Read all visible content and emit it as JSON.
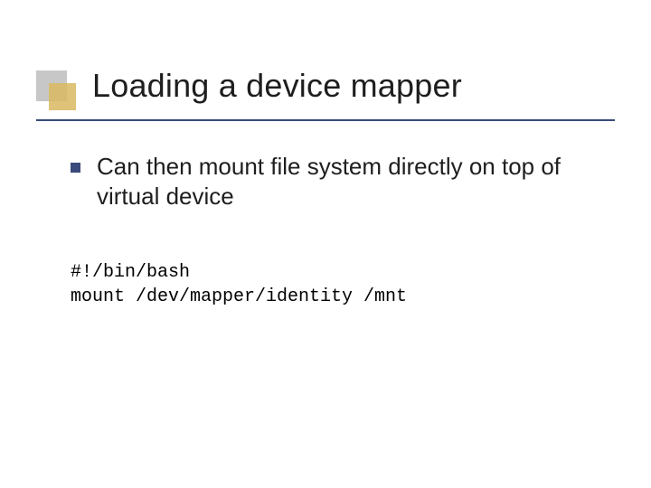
{
  "slide": {
    "title": "Loading a device mapper",
    "bullets": [
      {
        "text": "Can then mount file system directly on top of virtual device"
      }
    ],
    "code": {
      "line1": "#!/bin/bash",
      "line2": "mount /dev/mapper/identity /mnt"
    },
    "colors": {
      "accent": "#3a4a7a",
      "decor_gray": "#c7c7c7",
      "decor_gold": "#d8b860"
    }
  }
}
